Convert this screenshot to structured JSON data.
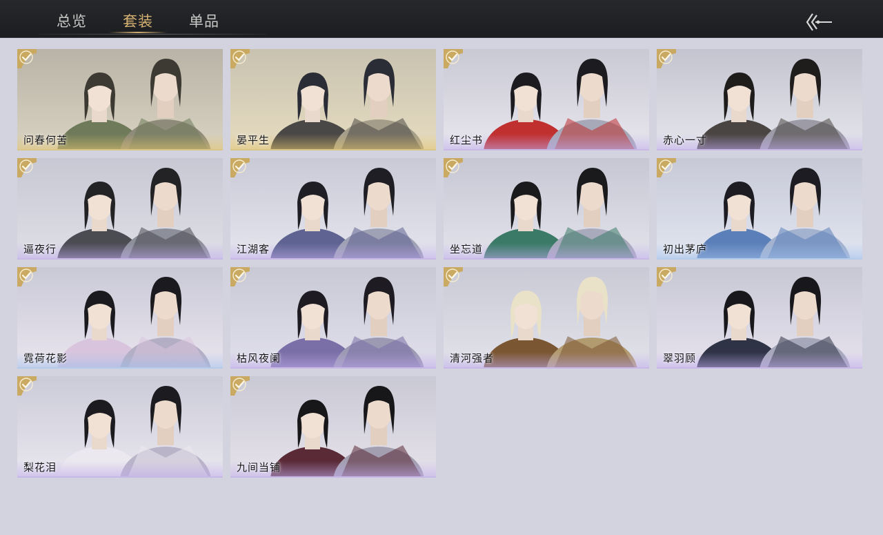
{
  "tabs": [
    {
      "label": "总览",
      "active": false
    },
    {
      "label": "套装",
      "active": true
    },
    {
      "label": "单品",
      "active": false
    }
  ],
  "back_icon": "back-arrow-icon",
  "check_icon": "checkmark-badge-icon",
  "colors": {
    "topbar": "#1d1f22",
    "background": "#d3d3e0",
    "active_tab": "#d7b273",
    "inactive_tab": "#c9c9c7",
    "check_badge": "#c9a85c"
  },
  "outfits": [
    {
      "name": "问春何苦",
      "rarity": "gold",
      "owned": true
    },
    {
      "name": "晏平生",
      "rarity": "gold",
      "owned": true
    },
    {
      "name": "红尘书",
      "rarity": "purple",
      "owned": true
    },
    {
      "name": "赤心一寸",
      "rarity": "purple",
      "owned": true
    },
    {
      "name": "逼夜行",
      "rarity": "purple",
      "owned": true
    },
    {
      "name": "江湖客",
      "rarity": "purple",
      "owned": true
    },
    {
      "name": "坐忘道",
      "rarity": "purple",
      "owned": true
    },
    {
      "name": "初出茅庐",
      "rarity": "blue",
      "owned": true
    },
    {
      "name": "霓荷花影",
      "rarity": "blue",
      "owned": true
    },
    {
      "name": "枯风夜阑",
      "rarity": "purple",
      "owned": true
    },
    {
      "name": "清河强者",
      "rarity": "purple",
      "owned": true
    },
    {
      "name": "翠羽顾",
      "rarity": "purple",
      "owned": true
    },
    {
      "name": "梨花泪",
      "rarity": "purple",
      "owned": true
    },
    {
      "name": "九间当铺",
      "rarity": "purple",
      "owned": true
    }
  ]
}
